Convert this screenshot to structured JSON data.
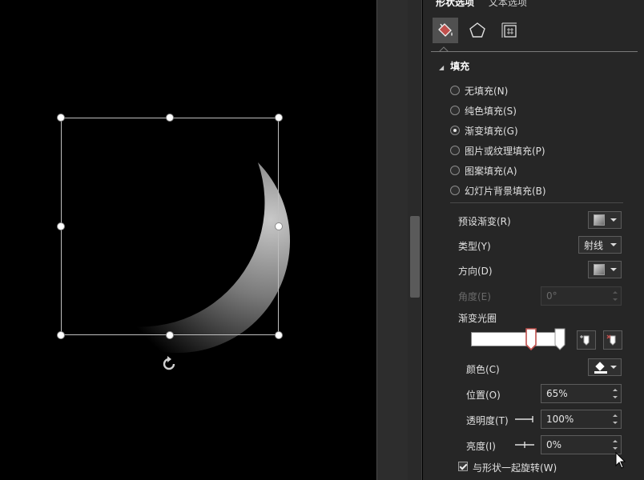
{
  "pane": {
    "tabs": {
      "shape_options": "形状选项",
      "text_options": "文本选项"
    },
    "section_fill": "填充",
    "fill_options": [
      {
        "label": "无填充(N)",
        "selected": false
      },
      {
        "label": "纯色填充(S)",
        "selected": false
      },
      {
        "label": "渐变填充(G)",
        "selected": true
      },
      {
        "label": "图片或纹理填充(P)",
        "selected": false
      },
      {
        "label": "图案填充(A)",
        "selected": false
      },
      {
        "label": "幻灯片背景填充(B)",
        "selected": false
      }
    ],
    "preset_gradient_label": "预设渐变(R)",
    "type_label": "类型(Y)",
    "type_value": "射线",
    "direction_label": "方向(D)",
    "angle_label": "角度(E)",
    "angle_value": "0°",
    "gradient_stops_label": "渐变光圈",
    "color_label": "颜色(C)",
    "position_label": "位置(O)",
    "position_value": "65%",
    "transparency_label": "透明度(T)",
    "transparency_value": "100%",
    "brightness_label": "亮度(I)",
    "brightness_value": "0%",
    "rotate_with_shape_label": "与形状一起旋转(W)",
    "rotate_with_shape_checked": true
  },
  "colors": {
    "pane_bg": "#262626",
    "canvas_bg": "#000000",
    "accent_fill_icon": "#c0504d"
  },
  "icons": {
    "fill_line": "paint-bucket-icon",
    "effects": "pentagon-icon",
    "size_properties": "size-properties-icon",
    "add_stop": "add-gradient-stop-icon",
    "remove_stop": "remove-gradient-stop-icon",
    "rotate": "rotate-handle-icon"
  }
}
